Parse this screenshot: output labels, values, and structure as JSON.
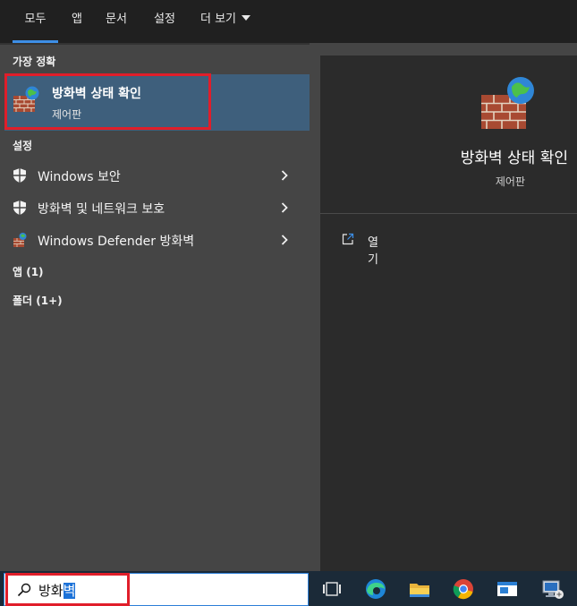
{
  "tabs": [
    {
      "label": "모두",
      "active": true
    },
    {
      "label": "앱"
    },
    {
      "label": "문서"
    },
    {
      "label": "설정"
    },
    {
      "label": "더 보기"
    }
  ],
  "results": {
    "best_match_header": "가장 정확",
    "best_match": {
      "title": "방화벽 상태 확인",
      "subtitle": "제어판",
      "icon": "firewall-icon"
    },
    "settings_header": "설정",
    "settings_items": [
      {
        "label": "Windows 보안",
        "icon": "shield-icon"
      },
      {
        "label": "방화벽 및 네트워크 보호",
        "icon": "shield-icon"
      },
      {
        "label": "Windows Defender 방화벽",
        "icon": "firewall-icon"
      }
    ],
    "apps_header": "앱 (1)",
    "folders_header": "폴더 (1+)"
  },
  "preview": {
    "title": "방화벽 상태 확인",
    "subtitle": "제어판",
    "actions": [
      {
        "label": "열기",
        "icon": "open-icon"
      }
    ]
  },
  "search": {
    "value_plain": "방화",
    "value_selected": "벽"
  },
  "taskbar": {
    "icons": [
      "task-view-icon",
      "edge-icon",
      "file-explorer-icon",
      "chrome-icon",
      "window-app-icon",
      "network-pc-icon"
    ]
  },
  "colors": {
    "accent": "#3d8ee6",
    "highlight": "#3e5f7c",
    "annotation_red": "#e01e2a"
  }
}
